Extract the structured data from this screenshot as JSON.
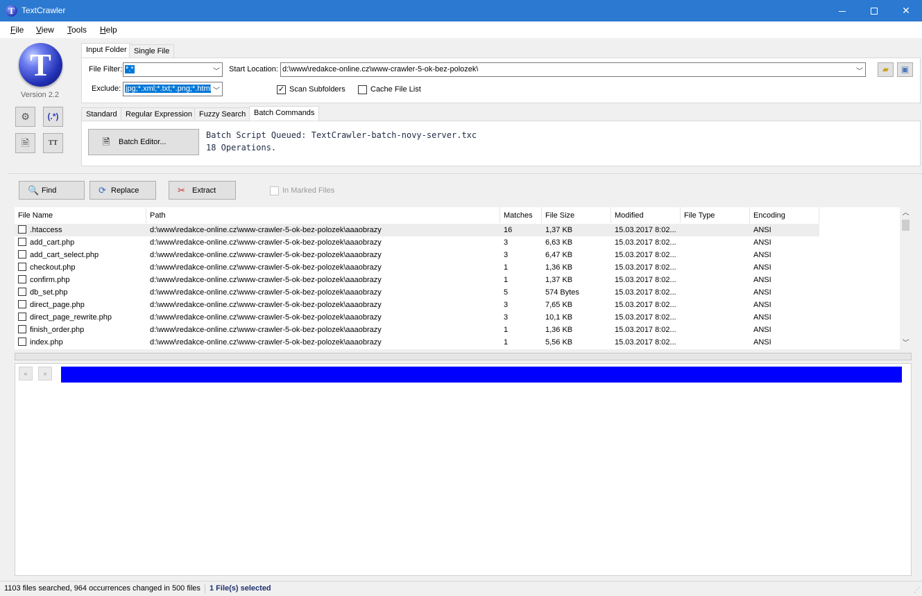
{
  "window": {
    "title": "TextCrawler",
    "minimize": "–",
    "maximize": "☐",
    "close": "✕"
  },
  "menu": [
    "File",
    "View",
    "Tools",
    "Help"
  ],
  "sidebar": {
    "logo_letter": "T",
    "version": "Version 2.2"
  },
  "input_tabs": [
    "Input Folder",
    "Single File"
  ],
  "file_filter": {
    "label": "File Filter:",
    "value": "*.*"
  },
  "exclude": {
    "label": "Exclude:",
    "value": "jpg;*.xml;*.txt;*.png;*.html"
  },
  "start_location": {
    "label": "Start Location:",
    "value": "d:\\www\\redakce-online.cz\\www-crawler-5-ok-bez-polozek\\"
  },
  "options": {
    "scan_subfolders": "Scan Subfolders",
    "scan_subfolders_checked": true,
    "cache_file_list": "Cache File List",
    "cache_file_list_checked": false
  },
  "search_tabs": [
    "Standard",
    "Regular Expression",
    "Fuzzy Search",
    "Batch Commands"
  ],
  "batch": {
    "editor_label": "Batch Editor...",
    "queued": "Batch Script Queued: TextCrawler-batch-novy-server.txc",
    "operations": "18 Operations."
  },
  "actions": {
    "find": "Find",
    "replace": "Replace",
    "extract": "Extract",
    "in_marked_files": "In Marked Files"
  },
  "table": {
    "columns": [
      "File Name",
      "Path",
      "Matches",
      "File Size",
      "Modified",
      "File Type",
      "Encoding"
    ],
    "rows": [
      [
        ".htaccess",
        "d:\\www\\redakce-online.cz\\www-crawler-5-ok-bez-polozek\\aaaobrazy",
        "16",
        "1,37 KB",
        "15.03.2017 8:02...",
        "",
        "ANSI"
      ],
      [
        "add_cart.php",
        "d:\\www\\redakce-online.cz\\www-crawler-5-ok-bez-polozek\\aaaobrazy",
        "3",
        "6,63 KB",
        "15.03.2017 8:02...",
        "",
        "ANSI"
      ],
      [
        "add_cart_select.php",
        "d:\\www\\redakce-online.cz\\www-crawler-5-ok-bez-polozek\\aaaobrazy",
        "3",
        "6,47 KB",
        "15.03.2017 8:02...",
        "",
        "ANSI"
      ],
      [
        "checkout.php",
        "d:\\www\\redakce-online.cz\\www-crawler-5-ok-bez-polozek\\aaaobrazy",
        "1",
        "1,36 KB",
        "15.03.2017 8:02...",
        "",
        "ANSI"
      ],
      [
        "confirm.php",
        "d:\\www\\redakce-online.cz\\www-crawler-5-ok-bez-polozek\\aaaobrazy",
        "1",
        "1,37 KB",
        "15.03.2017 8:02...",
        "",
        "ANSI"
      ],
      [
        "db_set.php",
        "d:\\www\\redakce-online.cz\\www-crawler-5-ok-bez-polozek\\aaaobrazy",
        "5",
        "574 Bytes",
        "15.03.2017 8:02...",
        "",
        "ANSI"
      ],
      [
        "direct_page.php",
        "d:\\www\\redakce-online.cz\\www-crawler-5-ok-bez-polozek\\aaaobrazy",
        "3",
        "7,65 KB",
        "15.03.2017 8:02...",
        "",
        "ANSI"
      ],
      [
        "direct_page_rewrite.php",
        "d:\\www\\redakce-online.cz\\www-crawler-5-ok-bez-polozek\\aaaobrazy",
        "3",
        "10,1 KB",
        "15.03.2017 8:02...",
        "",
        "ANSI"
      ],
      [
        "finish_order.php",
        "d:\\www\\redakce-online.cz\\www-crawler-5-ok-bez-polozek\\aaaobrazy",
        "1",
        "1,36 KB",
        "15.03.2017 8:02...",
        "",
        "ANSI"
      ],
      [
        "index.php",
        "d:\\www\\redakce-online.cz\\www-crawler-5-ok-bez-polozek\\aaaobrazy",
        "1",
        "5,56 KB",
        "15.03.2017 8:02...",
        "",
        "ANSI"
      ]
    ]
  },
  "preview": {
    "prev": "«",
    "next": "»"
  },
  "status": {
    "left": "1103 files searched, 964 occurrences changed in 500 files",
    "right": "1 File(s) selected"
  }
}
